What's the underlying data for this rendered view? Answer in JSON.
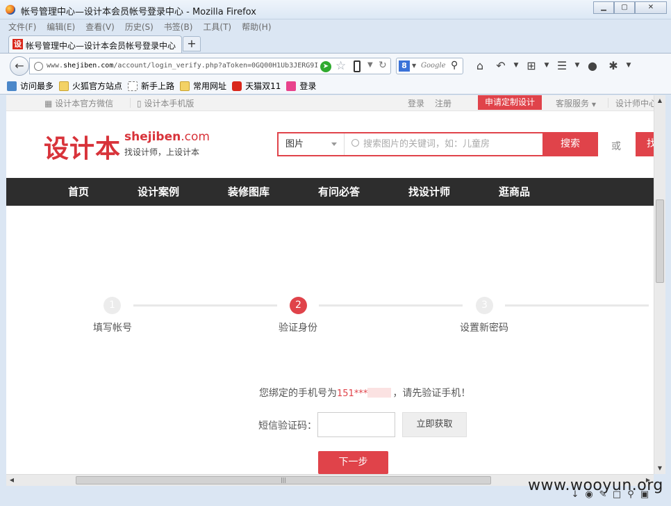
{
  "window": {
    "title": "帐号管理中心—设计本会员帐号登录中心 - Mozilla Firefox",
    "controls": {
      "minimize": "▁",
      "maximize": "▢",
      "close": "✕"
    }
  },
  "menu": [
    "文件(F)",
    "编辑(E)",
    "查看(V)",
    "历史(S)",
    "书签(B)",
    "工具(T)",
    "帮助(H)"
  ],
  "tab": {
    "favicon": "设",
    "label": "帐号管理中心—设计本会员帐号登录中心",
    "new_tab": "+"
  },
  "urlbar": {
    "prefix": "www.",
    "host": "shejiben.com",
    "path": "/account/login_verify.php?aToken=0GQ00H1Ub3JERG9I"
  },
  "search": {
    "engine_icon": "8",
    "engine_name": "Google"
  },
  "toolbar_icons": [
    "home-icon",
    "undo-icon",
    "crop-icon",
    "translate-icon",
    "chat-icon",
    "bug-icon"
  ],
  "bookmarks": [
    {
      "label": "访问最多",
      "icon": "blue"
    },
    {
      "label": "火狐官方站点",
      "icon": "folder"
    },
    {
      "label": "新手上路",
      "icon": "dashed"
    },
    {
      "label": "常用网址",
      "icon": "folder"
    },
    {
      "label": "天猫双11",
      "icon": "tmall"
    },
    {
      "label": "登录",
      "icon": "pink"
    }
  ],
  "site": {
    "topstrip": {
      "wechat": "设计本官方微信",
      "mobile": "设计本手机版",
      "login": "登录",
      "register": "注册",
      "apply": "申请定制设计",
      "service": "客服服务",
      "designer_center": "设计师中心"
    },
    "logo": {
      "cn": "设计本",
      "en_main": "shejiben",
      "en_com": ".com",
      "slogan": "找设计师，上设计本"
    },
    "search": {
      "category": "图片",
      "placeholder": "搜索图片的关键词，如：儿童房",
      "button": "搜索",
      "or": "或",
      "register_button": "找"
    },
    "nav": [
      "首页",
      "设计案例",
      "装修图库",
      "有问必答",
      "找设计师",
      "逛商品"
    ],
    "steps": [
      {
        "num": "1",
        "label": "填写帐号",
        "active": false
      },
      {
        "num": "2",
        "label": "验证身份",
        "active": true
      },
      {
        "num": "3",
        "label": "设置新密码",
        "active": false
      }
    ],
    "verify": {
      "msg_prefix": "您绑定的手机号为",
      "phone": "151***",
      "msg_suffix": "，请先验证手机！",
      "sms_label": "短信验证码：",
      "sms_value": "",
      "get_code": "立即获取",
      "next": "下一步"
    }
  },
  "watermark": "www.wooyun.org"
}
